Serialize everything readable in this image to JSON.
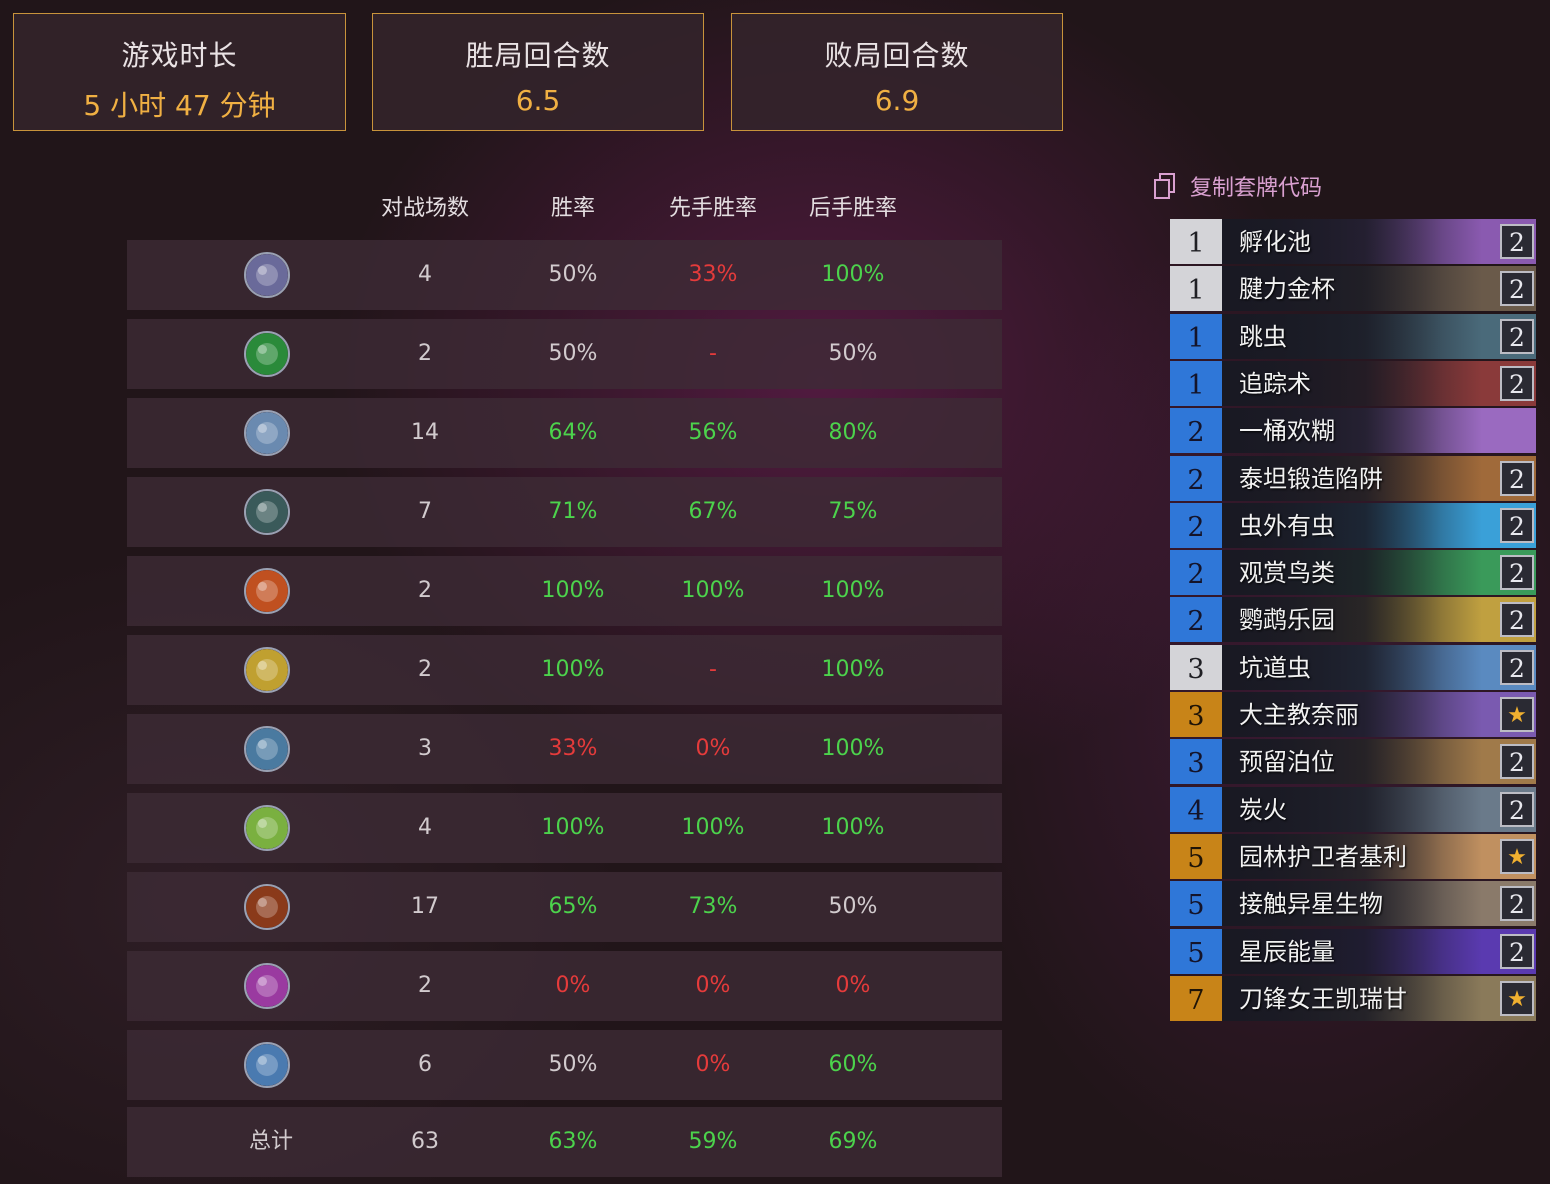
{
  "stats": [
    {
      "label": "游戏时长",
      "value": "5 小时 47 分钟"
    },
    {
      "label": "胜局回合数",
      "value": "6.5"
    },
    {
      "label": "败局回合数",
      "value": "6.9"
    }
  ],
  "table": {
    "headers": [
      "对战场数",
      "胜率",
      "先手胜率",
      "后手胜率"
    ],
    "rows": [
      {
        "icon": "class-icon-demon-hunter",
        "games": "4",
        "winrate": "50%",
        "first": "33%",
        "second": "100%",
        "colors": [
          "neutral",
          "red",
          "green"
        ]
      },
      {
        "icon": "class-icon-rogue",
        "games": "2",
        "winrate": "50%",
        "first": "-",
        "second": "50%",
        "colors": [
          "neutral",
          "red",
          "neutral"
        ]
      },
      {
        "icon": "class-icon-shaman",
        "games": "14",
        "winrate": "64%",
        "first": "56%",
        "second": "80%",
        "colors": [
          "green",
          "green",
          "green"
        ]
      },
      {
        "icon": "class-icon-hunter",
        "games": "7",
        "winrate": "71%",
        "first": "67%",
        "second": "75%",
        "colors": [
          "green",
          "green",
          "green"
        ]
      },
      {
        "icon": "class-icon-mage",
        "games": "2",
        "winrate": "100%",
        "first": "100%",
        "second": "100%",
        "colors": [
          "green",
          "green",
          "green"
        ]
      },
      {
        "icon": "class-icon-paladin",
        "games": "2",
        "winrate": "100%",
        "first": "-",
        "second": "100%",
        "colors": [
          "green",
          "red",
          "green"
        ]
      },
      {
        "icon": "class-icon-death-knight",
        "games": "3",
        "winrate": "33%",
        "first": "0%",
        "second": "100%",
        "colors": [
          "red",
          "red",
          "green"
        ]
      },
      {
        "icon": "class-icon-druid",
        "games": "4",
        "winrate": "100%",
        "first": "100%",
        "second": "100%",
        "colors": [
          "green",
          "green",
          "green"
        ]
      },
      {
        "icon": "class-icon-warlock",
        "games": "17",
        "winrate": "65%",
        "first": "73%",
        "second": "50%",
        "colors": [
          "green",
          "green",
          "neutral"
        ]
      },
      {
        "icon": "class-icon-priest",
        "games": "2",
        "winrate": "0%",
        "first": "0%",
        "second": "0%",
        "colors": [
          "red",
          "red",
          "red"
        ]
      },
      {
        "icon": "class-icon-warrior",
        "games": "6",
        "winrate": "50%",
        "first": "0%",
        "second": "60%",
        "colors": [
          "neutral",
          "red",
          "green"
        ]
      }
    ],
    "total": {
      "label": "总计",
      "games": "63",
      "winrate": "63%",
      "first": "59%",
      "second": "69%"
    }
  },
  "deck": {
    "copy_label": "复制套牌代码",
    "cards": [
      {
        "cost": "1",
        "name": "孵化池",
        "count": "2",
        "rarity": "white",
        "art": "#8a5ab0"
      },
      {
        "cost": "1",
        "name": "腱力金杯",
        "count": "2",
        "rarity": "white",
        "art": "#6a5a4a"
      },
      {
        "cost": "1",
        "name": "跳虫",
        "count": "2",
        "rarity": "blue",
        "art": "#4a6a7a"
      },
      {
        "cost": "1",
        "name": "追踪术",
        "count": "2",
        "rarity": "blue",
        "art": "#8a3a3a"
      },
      {
        "cost": "2",
        "name": "一桶欢糊",
        "count": "",
        "rarity": "blue",
        "art": "#9a6ac0"
      },
      {
        "cost": "2",
        "name": "泰坦锻造陷阱",
        "count": "2",
        "rarity": "blue",
        "art": "#a06a3a"
      },
      {
        "cost": "2",
        "name": "虫外有虫",
        "count": "2",
        "rarity": "blue",
        "art": "#3aa0d8"
      },
      {
        "cost": "2",
        "name": "观赏鸟类",
        "count": "2",
        "rarity": "blue",
        "art": "#3a9a5a"
      },
      {
        "cost": "2",
        "name": "鹦鹉乐园",
        "count": "2",
        "rarity": "blue",
        "art": "#c0a040"
      },
      {
        "cost": "3",
        "name": "坑道虫",
        "count": "2",
        "rarity": "white",
        "art": "#5a8ac0"
      },
      {
        "cost": "3",
        "name": "大主教奈丽",
        "count": "★",
        "rarity": "gold",
        "art": "#7a5ab0"
      },
      {
        "cost": "3",
        "name": "预留泊位",
        "count": "2",
        "rarity": "blue",
        "art": "#a07a4a"
      },
      {
        "cost": "4",
        "name": "炭火",
        "count": "2",
        "rarity": "blue",
        "art": "#6a7a8a"
      },
      {
        "cost": "5",
        "name": "园林护卫者基利",
        "count": "★",
        "rarity": "gold",
        "art": "#c09060"
      },
      {
        "cost": "5",
        "name": "接触异星生物",
        "count": "2",
        "rarity": "blue",
        "art": "#8a7a6a"
      },
      {
        "cost": "5",
        "name": "星辰能量",
        "count": "2",
        "rarity": "blue",
        "art": "#5a3ab0"
      },
      {
        "cost": "7",
        "name": "刀锋女王凯瑞甘",
        "count": "★",
        "rarity": "gold",
        "art": "#8a7a5a"
      }
    ]
  },
  "colors": {
    "accent": "#f0b043",
    "border": "#c8933b",
    "win": "#4cd34c",
    "loss": "#e53b3b",
    "copy": "#d9a0d0"
  }
}
